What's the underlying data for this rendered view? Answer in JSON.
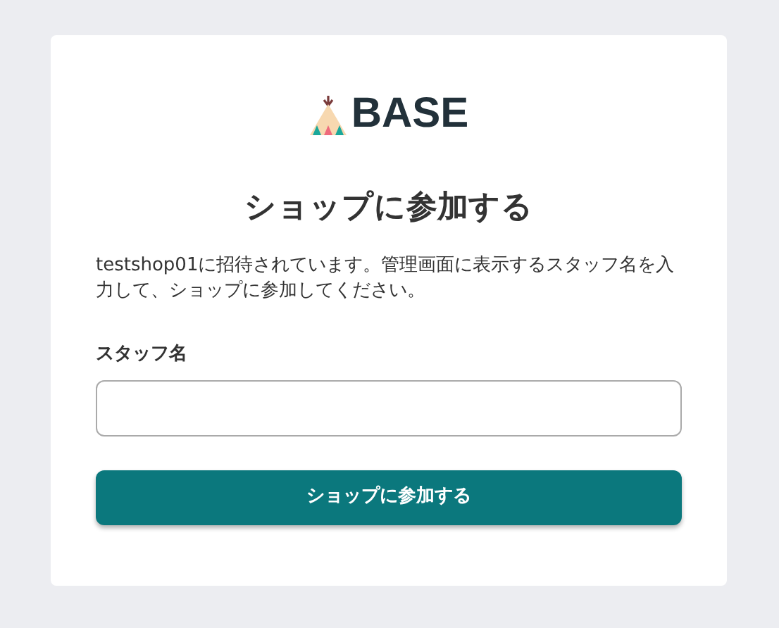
{
  "logo": {
    "text": "BASE"
  },
  "title": "ショップに参加する",
  "description": "testshop01に招待されています。管理画面に表示するスタッフ名を入力して、ショップに参加してください。",
  "field": {
    "label": "スタッフ名"
  },
  "button": {
    "label": "ショップに参加する"
  }
}
